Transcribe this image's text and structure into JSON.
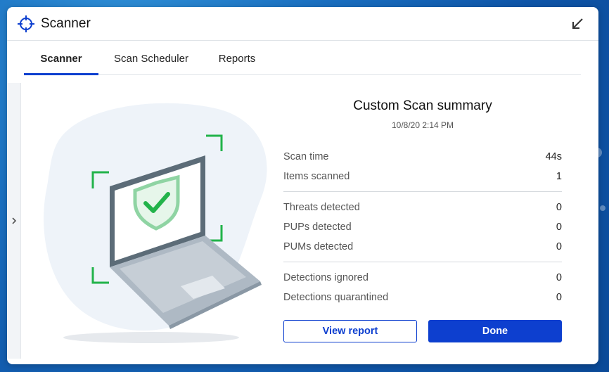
{
  "window": {
    "title": "Scanner",
    "title_icon": "crosshair-icon",
    "collapse_icon": "arrow-down-left-icon"
  },
  "tabs": [
    {
      "label": "Scanner",
      "active": true
    },
    {
      "label": "Scan Scheduler",
      "active": false
    },
    {
      "label": "Reports",
      "active": false
    }
  ],
  "summary": {
    "title": "Custom Scan summary",
    "date": "10/8/20 2:14 PM",
    "groups": [
      [
        {
          "label": "Scan time",
          "value": "44s"
        },
        {
          "label": "Items scanned",
          "value": "1"
        }
      ],
      [
        {
          "label": "Threats detected",
          "value": "0"
        },
        {
          "label": "PUPs detected",
          "value": "0"
        },
        {
          "label": "PUMs detected",
          "value": "0"
        }
      ],
      [
        {
          "label": "Detections ignored",
          "value": "0"
        },
        {
          "label": "Detections quarantined",
          "value": "0"
        }
      ]
    ]
  },
  "buttons": {
    "view_report": "View report",
    "done": "Done"
  },
  "side_panel": {
    "icon": "chevron-right-icon"
  },
  "illustration": {
    "icon": "laptop-shield-check-icon"
  },
  "colors": {
    "accent": "#0d3fcf",
    "check_green": "#22b34a"
  }
}
